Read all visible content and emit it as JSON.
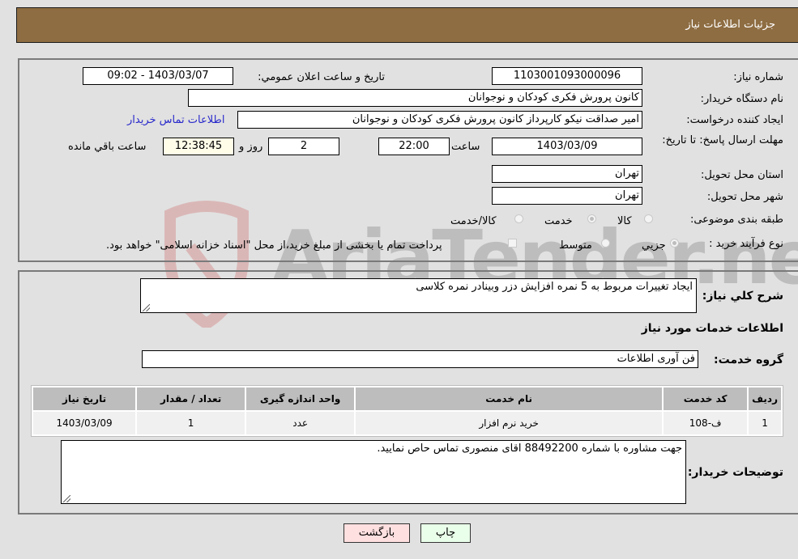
{
  "header": {
    "title": "جزئیات اطلاعات نیاز"
  },
  "details": {
    "need_number_label": "شماره نیاز:",
    "need_number": "1103001093000096",
    "announce_label": "تاريخ و ساعت اعلان عمومي:",
    "announce_value": "1403/03/07 - 09:02",
    "buyer_org_label": "نام دستگاه خريدار:",
    "buyer_org": "کانون پرورش فکری کودکان و نوجوانان",
    "creator_label": "ايجاد کننده درخواست:",
    "creator": "امیر صداقت نیکو کارپرداز کانون پرورش فکری کودکان و نوجوانان",
    "buyer_contact_link": "اطلاعات تماس خريدار",
    "deadline_label": "مهلت ارسال پاسخ: تا تاريخ:",
    "deadline_date": "1403/03/09",
    "time_label": "ساعت",
    "deadline_time": "22:00",
    "days_value": "2",
    "days_label": "روز و",
    "remaining_time": "12:38:45",
    "remaining_label": "ساعت باقي مانده",
    "province_label": "استان محل تحويل:",
    "province": "تهران",
    "city_label": "شهر محل تحويل:",
    "city": "تهران",
    "category_label": "طبقه بندی موضوعی:",
    "category_options": [
      {
        "label": "کالا",
        "selected": false
      },
      {
        "label": "خدمت",
        "selected": true
      },
      {
        "label": "کالا/خدمت",
        "selected": false
      }
    ],
    "process_label": "نوع فرآيند خريد :",
    "process_options": [
      {
        "label": "جزيي",
        "selected": true
      },
      {
        "label": "متوسط",
        "selected": false
      }
    ],
    "treasury_note": "پرداخت تمام يا بخشی از مبلغ خريد،از محل \"اسناد خزانه اسلامی\" خواهد بود."
  },
  "description": {
    "label": "شرح کلي نياز:",
    "value": "ایجاد تغییرات مربوط به 5 نمره افزایش دزر وبینادر نمره کلاسی"
  },
  "services": {
    "section_title": "اطلاعات خدمات مورد نياز",
    "group_label": "گروه خدمت:",
    "group_value": "فن آوری اطلاعات",
    "columns": [
      "رديف",
      "کد خدمت",
      "نام خدمت",
      "واحد اندازه گيری",
      "تعداد / مقدار",
      "تاريخ نياز"
    ],
    "rows": [
      {
        "row": "1",
        "code": "ف-108",
        "name": "خرید نرم افزار",
        "unit": "عدد",
        "qty": "1",
        "date": "1403/03/09"
      }
    ]
  },
  "buyer_notes": {
    "label": "توضيحات خريدار:",
    "value": "جهت مشاوره با شماره 88492200 اقای منصوری تماس حاص نمایید."
  },
  "buttons": {
    "print": "چاپ",
    "back": "بازگشت"
  },
  "watermark": {
    "text": "AriaTender.neT"
  }
}
